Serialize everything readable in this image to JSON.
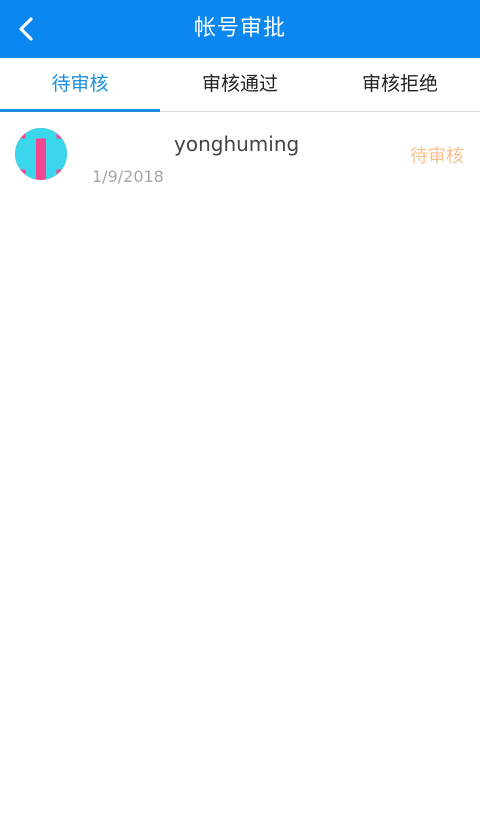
{
  "header": {
    "title": "帐号审批"
  },
  "tabs": [
    {
      "label": "待审核",
      "active": true
    },
    {
      "label": "审核通过",
      "active": false
    },
    {
      "label": "审核拒绝",
      "active": false
    }
  ],
  "list": [
    {
      "username": "yonghuming",
      "date": "1/9/2018",
      "status": "待审核"
    }
  ],
  "colors": {
    "navbar": "#0a87f0",
    "active_tab": "#1a8fe0",
    "status_pending": "#f7c08f",
    "avatar_bg": "#f0478f",
    "avatar_fg": "#3ad6ec"
  },
  "icons": {
    "back": "chevron-left-icon",
    "avatar": "identicon-avatar"
  }
}
